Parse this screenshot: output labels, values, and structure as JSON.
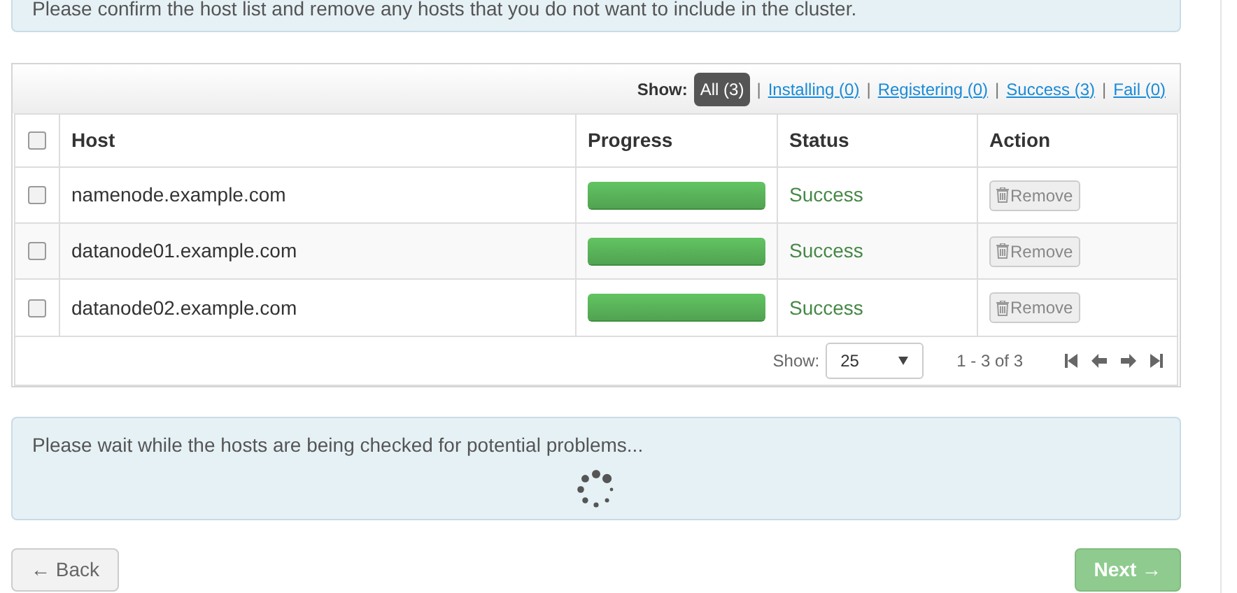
{
  "top_alert": {
    "text": "Please confirm the host list and remove any hosts that you do not want to include in the cluster."
  },
  "filter": {
    "label": "Show:",
    "options": [
      {
        "label": "All (3)",
        "selected": true
      },
      {
        "label": "Installing (0)",
        "selected": false
      },
      {
        "label": "Registering (0)",
        "selected": false
      },
      {
        "label": "Success (3)",
        "selected": false
      },
      {
        "label": "Fail (0)",
        "selected": false
      }
    ],
    "separator": "|"
  },
  "table": {
    "select_all": {
      "checked": false
    },
    "columns": [
      "Host",
      "Progress",
      "Status",
      "Action"
    ],
    "rows": [
      {
        "checked": false,
        "host": "namenode.example.com",
        "level": 1,
        "status": "Success",
        "action": {
          "label": "Remove",
          "disabled": true
        }
      },
      {
        "checked": false,
        "host": "datanode01.example.com",
        "level": 1,
        "status": "Success",
        "action": {
          "label": "Remove",
          "disabled": true
        }
      },
      {
        "checked": false,
        "host": "datanode02.example.com",
        "level": 1,
        "status": "Success",
        "action": {
          "label": "Remove",
          "disabled": true
        }
      }
    ]
  },
  "pagination": {
    "label": "Show:",
    "page_size": "25",
    "range": "1 - 3 of 3"
  },
  "check_alert": {
    "text": "Please wait while the hosts are being checked for potential problems...",
    "loading": true
  },
  "buttons": [
    {
      "label": "← Back",
      "kind": "back",
      "disabled": false
    },
    {
      "label": "Next →",
      "kind": "next",
      "disabled": true
    }
  ]
}
